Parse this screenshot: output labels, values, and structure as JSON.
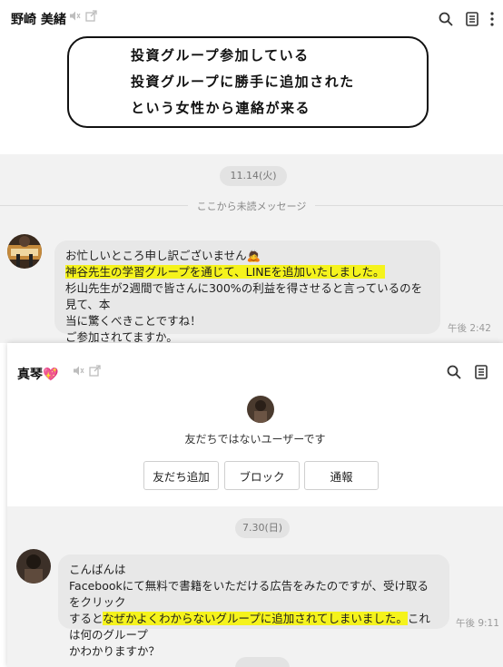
{
  "top_chat": {
    "contact_name": "野崎 美緒",
    "date_label": "11.14(火)",
    "unread_label": "ここから未読メッセージ",
    "message": {
      "line1": "お忙しいところ申し訳ございません",
      "line1_emoji": "🙇",
      "line2_highlight": "神谷先生の学習グループを通じて、LINEを追加いたしました。",
      "line3": "杉山先生が2週間で皆さんに300%の利益を得させると言っているのを見て、本",
      "line4": "当に驚くべきことですね！",
      "line5": "ご参加されてますか。",
      "time": "午後 2:42"
    }
  },
  "caption": {
    "lines": [
      "投資グループ参加している",
      "投資グループに勝手に追加された",
      "という女性から連絡が来る"
    ]
  },
  "second_chat": {
    "contact_name": "真琴",
    "contact_emoji": "💖",
    "non_friend_notice": "友だちではないユーザーです",
    "buttons": {
      "add_friend": "友だち追加",
      "block": "ブロック",
      "report": "通報"
    },
    "date_label": "7.30(日)",
    "message": {
      "line1": "こんばんは",
      "line2": "Facebookにて無料で書籍をいただける広告をみたのですが、受け取るをクリック",
      "line3_pre": "すると",
      "line3_highlight": "なぜかよくわからないグループに追加されてしまいました。",
      "line3_post": "これは何のグループ",
      "line4": "かわかりますか？",
      "time": "午後 9:11"
    }
  },
  "icons": {
    "mute": "speaker-muted-icon",
    "popout": "popout-icon",
    "search": "search-icon",
    "notes": "notes-icon",
    "menu": "more-vertical-icon"
  }
}
